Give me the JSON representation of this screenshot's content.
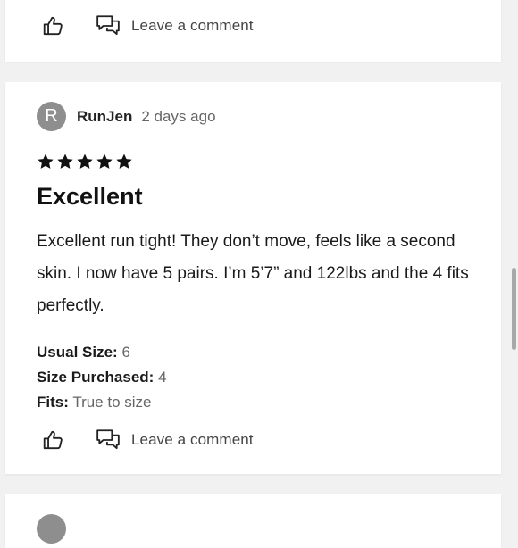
{
  "reviews": [
    {
      "comment_label": "Leave a comment"
    },
    {
      "author": {
        "initial": "R",
        "name": "RunJen",
        "time": "2 days ago"
      },
      "rating": 5,
      "title": "Excellent",
      "body": "Excellent run tight! They don’t move, feels like a second skin. I now have 5 pairs. I’m 5’7” and 122lbs and the 4 fits perfectly.",
      "details": {
        "usual_size_label": "Usual Size:",
        "usual_size_value": "6",
        "purchased_label": "Size Purchased:",
        "purchased_value": "4",
        "fits_label": "Fits:",
        "fits_value": "True to size"
      },
      "comment_label": "Leave a comment"
    }
  ],
  "icons": {
    "like": "thumbs-up-icon",
    "comment": "chat-bubbles-icon",
    "star": "star-icon"
  },
  "colors": {
    "background": "#f1f1f1",
    "card": "#ffffff",
    "avatar": "#8e8e8e",
    "text": "#111111",
    "muted": "#666666"
  }
}
